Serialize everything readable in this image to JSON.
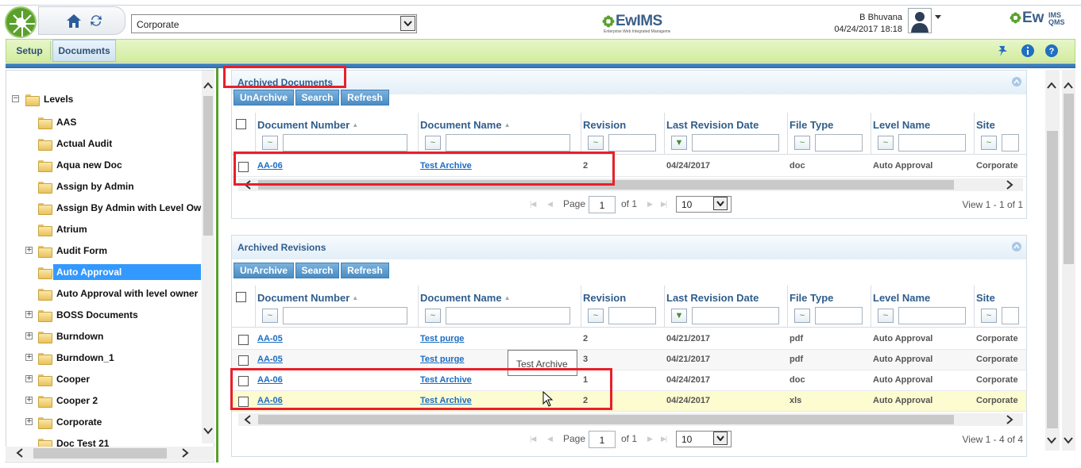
{
  "header": {
    "org_select_value": "Corporate",
    "brand_center": "EwIMS",
    "brand_center_tagline": "Enterprise Web Integrated Management Systems",
    "user_name": "B Bhuvana",
    "datetime": "04/24/2017 18:18",
    "brand_right": "Ew",
    "brand_right_sub_top": "IMS",
    "brand_right_sub_bottom": "QMS"
  },
  "nav": {
    "tabs": [
      "Setup",
      "Documents"
    ],
    "active_tab": "Documents",
    "icons": [
      "pin-icon",
      "info-icon",
      "help-icon"
    ]
  },
  "tree": {
    "root": "Levels",
    "items": [
      {
        "label": "AAS",
        "expandable": false
      },
      {
        "label": "Actual Audit",
        "expandable": false
      },
      {
        "label": "Aqua new Doc",
        "expandable": false
      },
      {
        "label": "Assign by Admin",
        "expandable": false
      },
      {
        "label": "Assign By Admin with Level Owr",
        "expandable": false
      },
      {
        "label": "Atrium",
        "expandable": false
      },
      {
        "label": "Audit Form",
        "expandable": true
      },
      {
        "label": "Auto Approval",
        "expandable": false,
        "selected": true
      },
      {
        "label": "Auto Approval with level owner",
        "expandable": false
      },
      {
        "label": "BOSS Documents",
        "expandable": true
      },
      {
        "label": "Burndown",
        "expandable": true
      },
      {
        "label": "Burndown_1",
        "expandable": true
      },
      {
        "label": "Cooper",
        "expandable": true
      },
      {
        "label": "Cooper 2",
        "expandable": true
      },
      {
        "label": "Corporate",
        "expandable": true
      },
      {
        "label": "Doc Test 21",
        "expandable": false
      }
    ]
  },
  "archived_documents": {
    "title": "Archived Documents",
    "buttons": [
      "UnArchive",
      "Search",
      "Refresh"
    ],
    "columns": [
      "Document Number",
      "Document Name",
      "Revision",
      "Last Revision Date",
      "File Type",
      "Level Name",
      "Site"
    ],
    "rows": [
      [
        "AA-06",
        "Test Archive",
        "2",
        "04/24/2017",
        "doc",
        "Auto Approval",
        "Corporate"
      ]
    ],
    "pager": {
      "page_label": "Page",
      "page": "1",
      "of_label": "of 1",
      "page_size": "10",
      "view": "View 1 - 1 of 1"
    }
  },
  "archived_revisions": {
    "title": "Archived Revisions",
    "buttons": [
      "UnArchive",
      "Search",
      "Refresh"
    ],
    "columns": [
      "Document Number",
      "Document Name",
      "Revision",
      "Last Revision Date",
      "File Type",
      "Level Name",
      "Site"
    ],
    "rows": [
      [
        "AA-05",
        "Test purge",
        "2",
        "04/21/2017",
        "pdf",
        "Auto Approval",
        "Corporate"
      ],
      [
        "AA-05",
        "Test purge",
        "3",
        "04/21/2017",
        "pdf",
        "Auto Approval",
        "Corporate"
      ],
      [
        "AA-06",
        "Test Archive",
        "1",
        "04/24/2017",
        "doc",
        "Auto Approval",
        "Corporate"
      ],
      [
        "AA-06",
        "Test Archive",
        "2",
        "04/24/2017",
        "xls",
        "Auto Approval",
        "Corporate"
      ]
    ],
    "pager": {
      "page_label": "Page",
      "page": "1",
      "of_label": "of 1",
      "page_size": "10",
      "view": "View 1 - 4 of 4"
    }
  },
  "tooltip": "Test Archive",
  "colors": {
    "accent_green": "#5aa02c",
    "header_blue": "#2f5d8c",
    "link_blue": "#1a6dc4",
    "selected": "#3399ff",
    "annotation_red": "#e8202a"
  }
}
